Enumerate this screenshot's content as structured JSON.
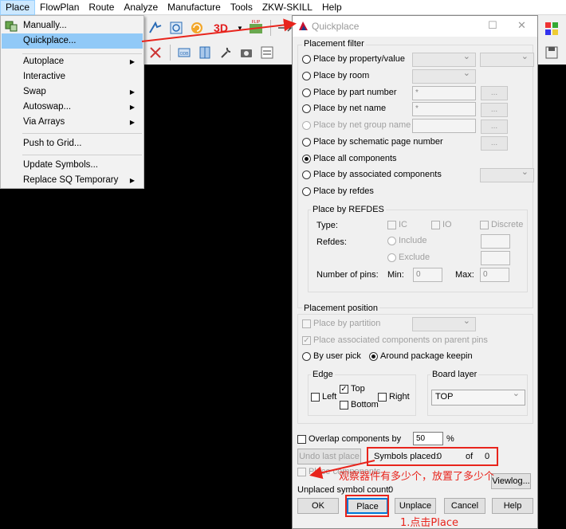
{
  "menubar": {
    "items": [
      "Place",
      "FlowPlan",
      "Route",
      "Analyze",
      "Manufacture",
      "Tools",
      "ZKW-SKILL",
      "Help"
    ]
  },
  "place_menu": {
    "items": [
      {
        "label": "Manually...",
        "submenu": false
      },
      {
        "label": "Quickplace...",
        "submenu": false,
        "highlighted": true
      },
      {
        "label": "Autoplace",
        "submenu": true
      },
      {
        "label": "Interactive",
        "submenu": false
      },
      {
        "label": "Swap",
        "submenu": true
      },
      {
        "label": "Autoswap...",
        "submenu": true
      },
      {
        "label": "Via Arrays",
        "submenu": true
      },
      {
        "label": "Push to Grid...",
        "submenu": false
      },
      {
        "label": "Update Symbols...",
        "submenu": false
      },
      {
        "label": "Replace SQ Temporary",
        "submenu": true
      }
    ],
    "submenu_arrow": "▶"
  },
  "toolbar": {
    "label_3d": "3D",
    "label_flip": "FLIP",
    "label_odb": "ODB"
  },
  "dialog": {
    "title": "Quickplace",
    "close_glyph": "✕",
    "maximize_glyph": "☐",
    "placement_filter": {
      "label": "Placement filter",
      "options": [
        "Place by property/value",
        "Place by room",
        "Place by part number",
        "Place by net name",
        "Place by net group name",
        "Place by schematic page number",
        "Place all components",
        "Place by associated components",
        "Place by refdes"
      ],
      "part_number_value": "*",
      "net_name_value": "*",
      "browse_label": "..."
    },
    "refdes_group": {
      "label": "Place by REFDES",
      "type_label": "Type:",
      "type_ic": "IC",
      "type_io": "IO",
      "type_discrete": "Discrete",
      "refdes_label": "Refdes:",
      "include": "Include",
      "exclude": "Exclude",
      "num_pins_label": "Number of pins:",
      "min_label": "Min:",
      "min_value": "0",
      "max_label": "Max:",
      "max_value": "0"
    },
    "placement_position": {
      "label": "Placement position",
      "by_partition": "Place by partition",
      "assoc_parent_pins": "Place associated components on parent pins",
      "by_user_pick": "By user pick",
      "around_keepin": "Around package keepin"
    },
    "edge": {
      "label": "Edge",
      "left": "Left",
      "top": "Top",
      "right": "Right",
      "bottom": "Bottom",
      "top_checked": true
    },
    "board_layer": {
      "label": "Board layer",
      "value": "TOP"
    },
    "overlap": {
      "label": "Overlap components by",
      "value": "50",
      "unit": "%"
    },
    "undo_last": "Undo last place",
    "symbols_placed_label": "Symbols placed:",
    "symbols_placed_value": "0",
    "of_label": "of",
    "of_value": "0",
    "place_comp_label": "Place components",
    "viewlog_label": "Viewlog...",
    "unplaced_label": "Unplaced symbol count:",
    "unplaced_value": "0",
    "buttons": {
      "ok": "OK",
      "place": "Place",
      "unplace": "Unplace",
      "cancel": "Cancel",
      "help": "Help"
    }
  },
  "annotations": {
    "observe_note": "观察器件有多少个，放置了多少个",
    "click_place_note": "1.点击Place",
    "color": "#e8241c"
  }
}
